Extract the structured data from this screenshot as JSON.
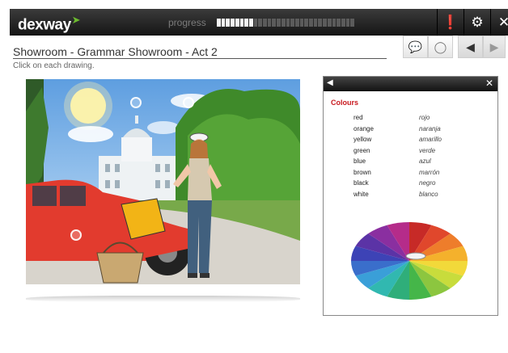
{
  "app": {
    "logo": "dexway",
    "progress_label": "progress",
    "progress": {
      "done": 8,
      "total": 30
    },
    "icons": [
      "info-icon",
      "gear-icon",
      "close-icon"
    ]
  },
  "toolbar": {
    "buttons": [
      "chat-icon",
      "lightbulb-icon",
      "previous-arrow-icon",
      "next-arrow-icon"
    ]
  },
  "page": {
    "title": "Showroom - Grammar Showroom - Act 2",
    "instruction": "Click on each drawing."
  },
  "popup": {
    "title": "Colours",
    "vocab": [
      {
        "en": "red",
        "es": "rojo"
      },
      {
        "en": "orange",
        "es": "naranja"
      },
      {
        "en": "yellow",
        "es": "amarillo"
      },
      {
        "en": "green",
        "es": "verde"
      },
      {
        "en": "blue",
        "es": "azul"
      },
      {
        "en": "brown",
        "es": "marrón"
      },
      {
        "en": "black",
        "es": "negro"
      },
      {
        "en": "white",
        "es": "blanco"
      }
    ]
  },
  "colors": {
    "accent": "#6dbb2f",
    "popup_title": "#c8181e",
    "topbar": "#1e1e1e"
  }
}
